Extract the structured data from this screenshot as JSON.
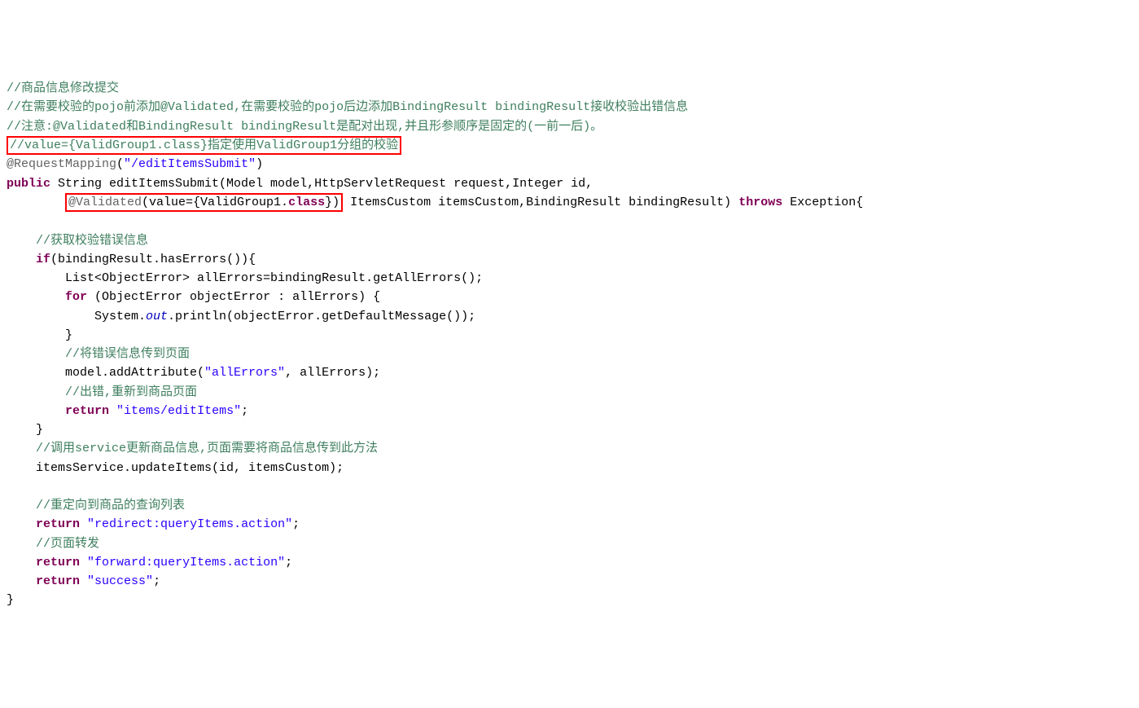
{
  "code": {
    "cmt1": "//商品信息修改提交",
    "cmt2_a": "//在需要校验的",
    "cmt2_b": "pojo",
    "cmt2_c": "前添加",
    "cmt2_d": "@Validated",
    "cmt2_e": ",在需要校验的",
    "cmt2_f": "pojo",
    "cmt2_g": "后边添加",
    "cmt2_h": "BindingResult bindingResult",
    "cmt2_i": "接收校验出错信息",
    "cmt3_a": "//注意:",
    "cmt3_b": "@Validated",
    "cmt3_c": "和",
    "cmt3_d": "BindingResult bindingResult",
    "cmt3_e": "是配对出现,并且形参顺序是固定的(一前一后)。",
    "cmt4_a": "//value={ValidGroup1.class}",
    "cmt4_b": "指定使用",
    "cmt4_c": "ValidGroup1",
    "cmt4_d": "分组的校验",
    "anno1_a": "@RequestMapping",
    "anno1_b": "(",
    "anno1_str": "\"/editItemsSubmit\"",
    "anno1_c": ")",
    "sig_public": "public",
    "sig_rest1": " String editItemsSubmit(Model model,HttpServletRequest request,Integer id,",
    "sig_indent": "        ",
    "sig_validated_a": "@Validated",
    "sig_validated_b": "(value={ValidGroup1.",
    "sig_validated_c": "class",
    "sig_validated_d": "})",
    "sig_rest2": " ItemsCustom itemsCustom,BindingResult bindingResult) ",
    "sig_throws": "throws",
    "sig_rest3": " Exception{",
    "cmt5": "    //获取校验错误信息",
    "if_kw": "if",
    "if_rest": "(bindingResult.hasErrors()){",
    "list_line": "        List<ObjectError> allErrors=bindingResult.getAllErrors();",
    "for_kw": "for",
    "for_rest": " (ObjectError objectError : allErrors) {",
    "sysout_a": "            System.",
    "sysout_out": "out",
    "sysout_b": ".println(objectError.getDefaultMessage());",
    "brace1": "        }",
    "cmt6": "        //将错误信息传到页面",
    "model_a": "        model.addAttribute(",
    "model_str": "\"allErrors\"",
    "model_b": ", allErrors);",
    "cmt7": "        //出错,重新到商品页面",
    "ret1_kw": "return",
    "ret1_sp": " ",
    "ret1_str": "\"items/editItems\"",
    "ret1_end": ";",
    "brace2": "    }",
    "cmt8_a": "    //调用",
    "cmt8_b": "service",
    "cmt8_c": "更新商品信息,页面需要将商品信息传到此方法",
    "upd_line": "    itemsService.updateItems(id, itemsCustom);",
    "cmt9": "    //重定向到商品的查询列表",
    "ret2_kw": "return",
    "ret2_str": "\"redirect:queryItems.action\"",
    "ret2_end": ";",
    "cmt10": "    //页面转发",
    "ret3_kw": "return",
    "ret3_str": "\"forward:queryItems.action\"",
    "ret3_end": ";",
    "ret4_kw": "return",
    "ret4_str": "\"success\"",
    "ret4_end": ";",
    "brace3": "}"
  }
}
